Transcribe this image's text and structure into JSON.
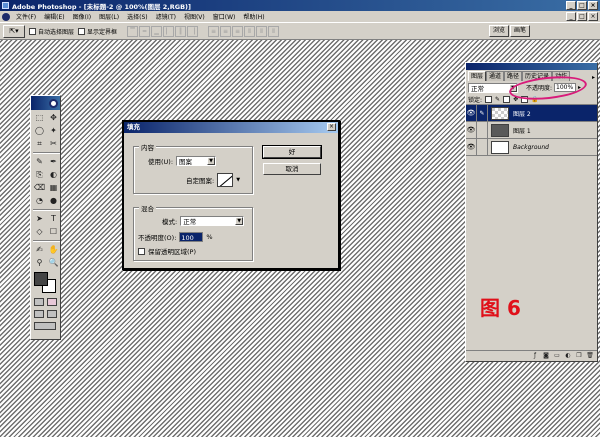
{
  "window": {
    "title": "Adobe Photoshop - [未标题-2 @ 100%(图层 2,RGB)]",
    "buttons": [
      "_",
      "□",
      "×"
    ]
  },
  "menubar": {
    "items": [
      "文件(F)",
      "编辑(E)",
      "图像(I)",
      "图层(L)",
      "选择(S)",
      "滤镜(T)",
      "视图(V)",
      "窗口(W)",
      "帮助(H)"
    ],
    "doc_buttons": [
      "_",
      "□",
      "×"
    ]
  },
  "options_bar": {
    "tool_icon": "move-tool-icon",
    "auto_select": "自动选择图层",
    "show_bounds": "显示定界框",
    "palette_tabs": [
      "浏览",
      "画笔"
    ]
  },
  "toolbox": {
    "tools": [
      "⬚",
      "✥",
      "◯",
      "✦",
      "⌗",
      "✂",
      "✎",
      "✒",
      "⎘",
      "◐",
      "⌫",
      "▦",
      "◔",
      "●",
      "➤",
      "T",
      "◇",
      "☐",
      "✍",
      "✋",
      "⚲",
      "🔍"
    ]
  },
  "fill_dialog": {
    "title": "填充",
    "close": "×",
    "content_group": {
      "label": "内容",
      "use_label": "使用(U):",
      "use_value": "图案",
      "pattern_label": "自定图案:"
    },
    "blend_group": {
      "label": "混合",
      "mode_label": "模式:",
      "mode_value": "正常",
      "opacity_label": "不透明度(O):",
      "opacity_value": "100",
      "opacity_unit": "%",
      "preserve_label": "保留透明区域(P)"
    },
    "ok": "好",
    "cancel": "取消"
  },
  "layers_palette": {
    "tabs": [
      "图层",
      "通道",
      "路径",
      "历史记录",
      "动作"
    ],
    "blend_mode": "正常",
    "opacity_label": "不透明度:",
    "opacity_value": "100%",
    "lock_label": "锁定:",
    "layers": [
      {
        "name": "图层 2",
        "active": true
      },
      {
        "name": "图层 1",
        "active": false
      },
      {
        "name": "Background",
        "active": false
      }
    ]
  },
  "annotation": {
    "label": "图 6",
    "color": "#e0101a",
    "ellipse_color": "#d81b7a"
  }
}
